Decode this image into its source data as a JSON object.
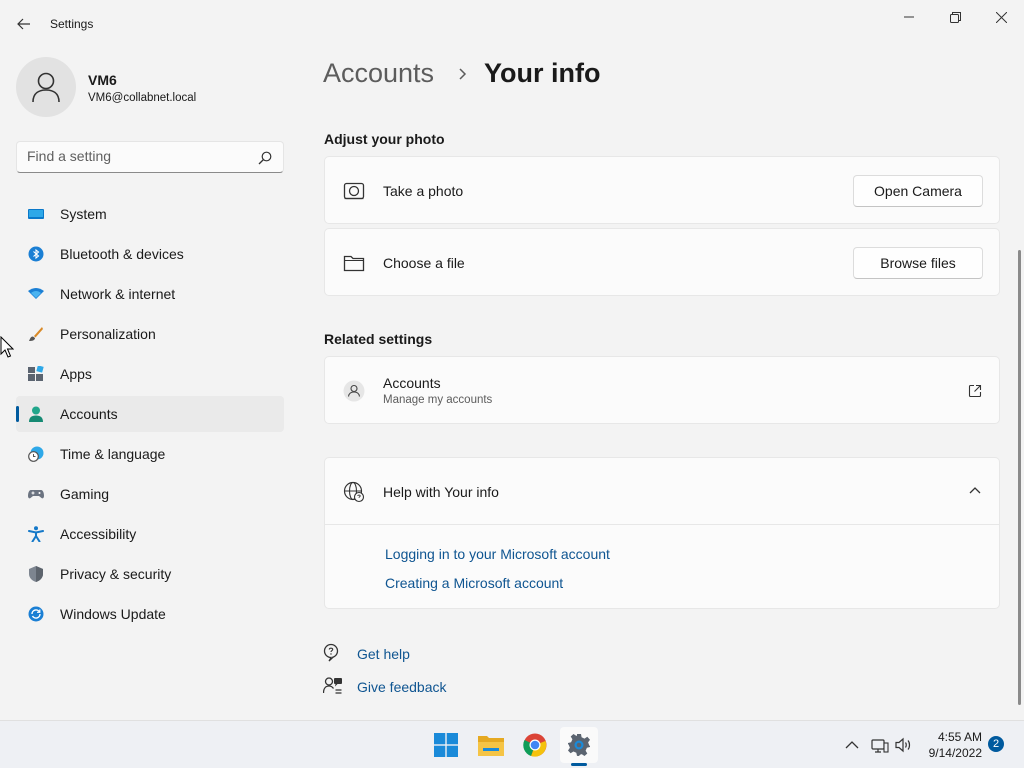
{
  "window": {
    "title": "Settings"
  },
  "profile": {
    "name": "VM6",
    "email": "VM6@collabnet.local"
  },
  "search": {
    "placeholder": "Find a setting",
    "value": ""
  },
  "sidebar": {
    "items": [
      {
        "label": "System",
        "icon": "system-icon"
      },
      {
        "label": "Bluetooth & devices",
        "icon": "bluetooth-icon"
      },
      {
        "label": "Network & internet",
        "icon": "wifi-icon"
      },
      {
        "label": "Personalization",
        "icon": "brush-icon"
      },
      {
        "label": "Apps",
        "icon": "apps-icon"
      },
      {
        "label": "Accounts",
        "icon": "accounts-icon",
        "active": true
      },
      {
        "label": "Time & language",
        "icon": "globe-clock-icon"
      },
      {
        "label": "Gaming",
        "icon": "gamepad-icon"
      },
      {
        "label": "Accessibility",
        "icon": "accessibility-icon"
      },
      {
        "label": "Privacy & security",
        "icon": "shield-icon"
      },
      {
        "label": "Windows Update",
        "icon": "update-icon"
      }
    ]
  },
  "breadcrumb": {
    "parent": "Accounts",
    "current": "Your info"
  },
  "photo_section": {
    "title": "Adjust your photo",
    "take_photo": {
      "label": "Take a photo",
      "button": "Open Camera"
    },
    "choose_file": {
      "label": "Choose a file",
      "button": "Browse files"
    }
  },
  "related_section": {
    "title": "Related settings",
    "accounts": {
      "label": "Accounts",
      "sublabel": "Manage my accounts"
    }
  },
  "help_section": {
    "title": "Help with Your info",
    "links": [
      "Logging in to your Microsoft account",
      "Creating a Microsoft account"
    ]
  },
  "footer": {
    "get_help": "Get help",
    "give_feedback": "Give feedback"
  },
  "taskbar": {
    "time": "4:55 AM",
    "date": "9/14/2022",
    "notification_count": "2"
  },
  "colors": {
    "accent": "#005a9e",
    "link": "#0f5591",
    "background": "#f3f3f3",
    "card": "#fbfbfb"
  }
}
